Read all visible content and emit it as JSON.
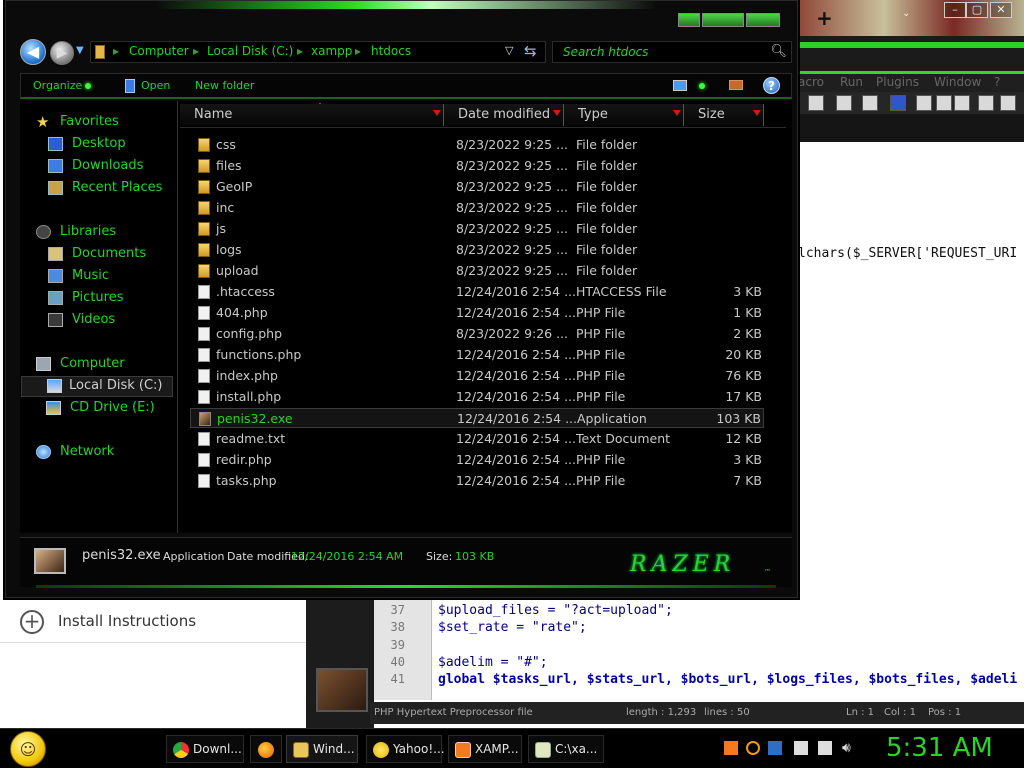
{
  "explorer": {
    "breadcrumbs": [
      "Computer",
      "Local Disk (C:)",
      "xampp",
      "htdocs"
    ],
    "search_placeholder": "Search htdocs",
    "commands": {
      "organize": "Organize",
      "open": "Open",
      "new_folder": "New folder"
    },
    "nav": {
      "favorites": "Favorites",
      "desktop": "Desktop",
      "downloads": "Downloads",
      "recent_places": "Recent Places",
      "libraries": "Libraries",
      "documents": "Documents",
      "music": "Music",
      "pictures": "Pictures",
      "videos": "Videos",
      "computer": "Computer",
      "local_disk": "Local Disk (C:)",
      "cd_drive": "CD Drive (E:)",
      "network": "Network"
    },
    "columns": {
      "name": "Name",
      "date": "Date modified",
      "type": "Type",
      "size": "Size"
    },
    "files": [
      {
        "name": "css",
        "date": "8/23/2022 9:25 ...",
        "type": "File folder",
        "size": "",
        "icon": "folder"
      },
      {
        "name": "files",
        "date": "8/23/2022 9:25 ...",
        "type": "File folder",
        "size": "",
        "icon": "folder"
      },
      {
        "name": "GeoIP",
        "date": "8/23/2022 9:25 ...",
        "type": "File folder",
        "size": "",
        "icon": "folder"
      },
      {
        "name": "inc",
        "date": "8/23/2022 9:25 ...",
        "type": "File folder",
        "size": "",
        "icon": "folder"
      },
      {
        "name": "js",
        "date": "8/23/2022 9:25 ...",
        "type": "File folder",
        "size": "",
        "icon": "folder"
      },
      {
        "name": "logs",
        "date": "8/23/2022 9:25 ...",
        "type": "File folder",
        "size": "",
        "icon": "folder"
      },
      {
        "name": "upload",
        "date": "8/23/2022 9:25 ...",
        "type": "File folder",
        "size": "",
        "icon": "folder"
      },
      {
        "name": ".htaccess",
        "date": "12/24/2016 2:54 ...",
        "type": "HTACCESS File",
        "size": "3 KB",
        "icon": "doc"
      },
      {
        "name": "404.php",
        "date": "12/24/2016 2:54 ...",
        "type": "PHP File",
        "size": "1 KB",
        "icon": "doc"
      },
      {
        "name": "config.php",
        "date": "8/23/2022 9:26 ...",
        "type": "PHP File",
        "size": "2 KB",
        "icon": "doc"
      },
      {
        "name": "functions.php",
        "date": "12/24/2016 2:54 ...",
        "type": "PHP File",
        "size": "20 KB",
        "icon": "doc"
      },
      {
        "name": "index.php",
        "date": "12/24/2016 2:54 ...",
        "type": "PHP File",
        "size": "76 KB",
        "icon": "doc"
      },
      {
        "name": "install.php",
        "date": "12/24/2016 2:54 ...",
        "type": "PHP File",
        "size": "17 KB",
        "icon": "doc"
      },
      {
        "name": "penis32.exe",
        "date": "12/24/2016 2:54 ...",
        "type": "Application",
        "size": "103 KB",
        "icon": "app",
        "selected": true
      },
      {
        "name": "readme.txt",
        "date": "12/24/2016 2:54 ...",
        "type": "Text Document",
        "size": "12 KB",
        "icon": "doc"
      },
      {
        "name": "redir.php",
        "date": "12/24/2016 2:54 ...",
        "type": "PHP File",
        "size": "3 KB",
        "icon": "doc"
      },
      {
        "name": "tasks.php",
        "date": "12/24/2016 2:54 ...",
        "type": "PHP File",
        "size": "7 KB",
        "icon": "doc"
      }
    ],
    "details": {
      "name": "penis32.exe",
      "type": "Application",
      "date_label": "Date modified:",
      "date_value": "12/24/2016 2:54 AM",
      "size_label": "Size:",
      "size_value": "103 KB"
    },
    "brand": "RAZER",
    "brand_tm": "™",
    "accent_color": "#29d32a"
  },
  "editor": {
    "code_fragment": "lchars($_SERVER['REQUEST_URI",
    "lines": [
      {
        "num": "37",
        "text": "$upload_files = \"?act=upload\";"
      },
      {
        "num": "38",
        "text": "$set_rate = \"rate\";"
      },
      {
        "num": "39",
        "text": ""
      },
      {
        "num": "40",
        "text": "$adelim = \"#\";"
      },
      {
        "num": "41",
        "text": "global $tasks_url, $stats_url, $bots_url, $logs_files, $bots_files, $adeli"
      }
    ],
    "status": {
      "file_type": "PHP Hypertext Preprocessor file",
      "length": "length : 1,293",
      "lines": "lines : 50",
      "ln": "Ln : 1",
      "col": "Col : 1",
      "pos": "Pos : 1"
    }
  },
  "page": {
    "install_label": "Install Instructions"
  },
  "taskbar": {
    "tasks": [
      {
        "label": "Downl...",
        "icon": "chrome-icon"
      },
      {
        "label": "",
        "icon": "firefox-icon"
      },
      {
        "label": "Wind...",
        "icon": "explorer-icon",
        "active": true
      },
      {
        "label": "Yahoo!...",
        "icon": "yahoo-icon"
      },
      {
        "label": "XAMP...",
        "icon": "xampp-icon"
      },
      {
        "label": "C:\\xa...",
        "icon": "notepad-icon"
      }
    ],
    "clock": "5:31 AM"
  }
}
